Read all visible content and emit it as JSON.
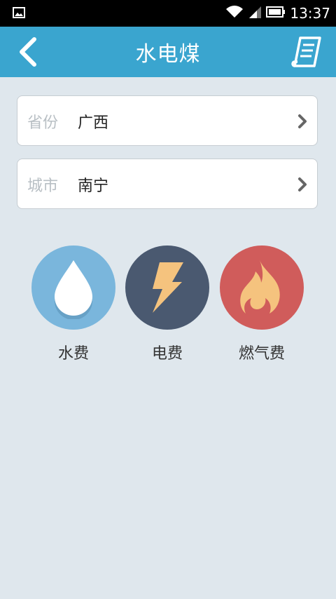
{
  "status_bar": {
    "time": "13:37",
    "icons": [
      "gallery-notification-icon",
      "wifi-icon",
      "signal-icon",
      "battery-icon"
    ]
  },
  "header": {
    "title": "水电煤",
    "back_icon": "chevron-left-icon",
    "records_icon": "receipt-list-icon",
    "background_color": "#3aa5cf"
  },
  "location": {
    "province": {
      "label": "省份",
      "value": "广西"
    },
    "city": {
      "label": "城市",
      "value": "南宁"
    }
  },
  "payment_types": [
    {
      "label": "水费",
      "icon": "water-drop-icon",
      "color": "#7ab6dc"
    },
    {
      "label": "电费",
      "icon": "lightning-icon",
      "color": "#4a5970"
    },
    {
      "label": "燃气费",
      "icon": "flame-icon",
      "color": "#d05c5b"
    }
  ]
}
